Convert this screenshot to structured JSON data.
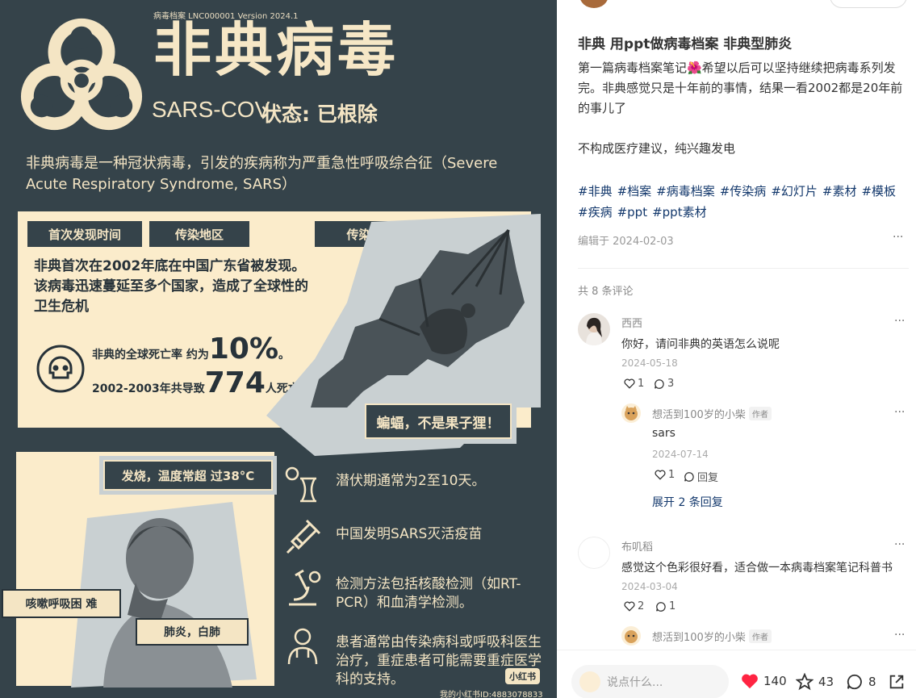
{
  "poster": {
    "meta": "病毒档案  LNC000001  Version 2024.1",
    "title": "非典病毒",
    "subtitle_en": "SARS-COV",
    "status": "状态: 已根除",
    "intro": "非典病毒是一种冠状病毒，引发的疾病称为严重急性呼吸综合征（Severe Acute Respiratory Syndrome, SARS）",
    "tags": [
      "首次发现时间",
      "传染地区",
      "传染源"
    ],
    "desc": "非典首次在2002年底在中国广东省被发现。该病毒迅速蔓延至多个国家，造成了全球性的卫生危机",
    "rate_prefix": "非典的全球死亡率 约为",
    "rate_value": "10%",
    "rate_suffix": "。",
    "deaths_prefix": "2002-2003年共导致",
    "deaths_value": "774",
    "deaths_suffix": "人死亡",
    "bat_label": "蝙蝠，不是果子狸！",
    "fever_label": "发烧，温度常超 过38°C",
    "cough_label": "咳嗽呼吸困 难",
    "pneumonia_label": "肺炎，白肺",
    "facts": [
      "潜伏期通常为2至10天。",
      "中国发明SARS灭活疫苗",
      "检测方法包括核酸检测（如RT-PCR）和血清学检测。",
      "患者通常由传染病科或呼吸科医生治疗，重症患者可能需要重症医学科的支持。"
    ],
    "watermark": "小红书",
    "uid": "我的小红书ID:4883078833"
  },
  "post": {
    "title": "非典 用ppt做病毒档案 非典型肺炎",
    "body": "第一篇病毒档案笔记🌺希望以后可以坚持继续把病毒系列发完。非典感觉只是十年前的事情，结果一看2002都是20年前的事儿了\n\n不构成医疗建议，纯兴趣发电",
    "tags": [
      "#非典",
      "#档案",
      "#病毒档案",
      "#传染病",
      "#幻灯片",
      "#素材",
      "#模板",
      "#疾病",
      "#ppt",
      "#ppt素材"
    ],
    "edited": "编辑于 2024-02-03",
    "more": "···"
  },
  "comments": {
    "count_label": "共 8 条评论",
    "c1": {
      "name": "西西",
      "text": "你好，请问非典的英语怎么说呢",
      "date": "2024-05-18",
      "likes": "1",
      "replies": "3"
    },
    "r1": {
      "name": "想活到100岁的小柴",
      "badge": "作者",
      "text": "sars",
      "date": "2024-07-14",
      "likes": "1",
      "reply_label": "回复"
    },
    "expand": "展开 2 条回复",
    "c2": {
      "name": "布叽稻",
      "text": "感觉这个色彩很好看，适合做一本病毒档案笔记科普书",
      "date": "2024-03-04",
      "likes": "2",
      "replies": "1"
    },
    "r2": {
      "name": "想活到100岁的小柴",
      "badge": "作者"
    },
    "more": "···"
  },
  "bottom": {
    "placeholder": "说点什么...",
    "likes": "140",
    "stars": "43",
    "comments": "8"
  },
  "colors": {
    "poster_bg": "#35434a",
    "cream": "#fbeccb",
    "like_red": "#ff2442",
    "tag_blue": "#13386c"
  }
}
